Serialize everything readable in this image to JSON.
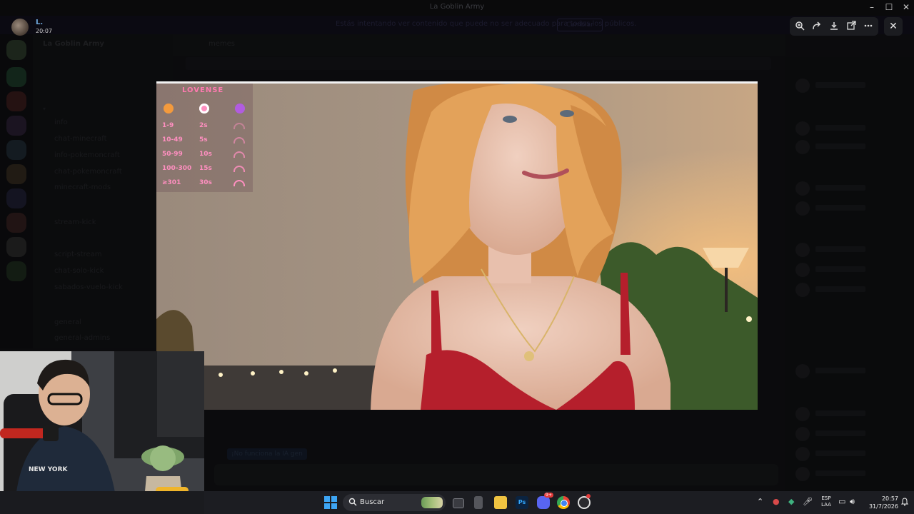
{
  "window": {
    "app_title": "La Goblin Army",
    "controls": {
      "minimize": "–",
      "maximize": "☐",
      "close": "✕"
    }
  },
  "banner": {
    "text": "Estás intentando ver contenido que puede no ser adecuado para todos los públicos.",
    "button": "Cambiar"
  },
  "user": {
    "name": "L.",
    "time": "20:07"
  },
  "server": {
    "name": "La Goblin Army",
    "channels": [
      {
        "label": "info"
      },
      {
        "label": "chat-minecraft"
      },
      {
        "label": "info-pokemoncraft"
      },
      {
        "label": "chat-pokemoncraft"
      },
      {
        "label": "minecraft-mods"
      },
      {
        "label": "stream-kick"
      },
      {
        "label": "script-stream"
      },
      {
        "label": "chat-solo-kick"
      },
      {
        "label": "sabados-vuelo-kick"
      },
      {
        "label": "general"
      },
      {
        "label": "general-admins"
      }
    ]
  },
  "chat": {
    "channel_name": "memes",
    "reply_button": "¡No funciona la IA gen"
  },
  "viewer": {
    "toolbar_icons": [
      "zoom-icon",
      "forward-icon",
      "download-icon",
      "open-external-icon",
      "more-icon"
    ],
    "close_symbol": "✕"
  },
  "lovense": {
    "logo": "LOVENSE",
    "levels": [
      {
        "tip": "1-9",
        "duration": "2s",
        "strength": 0.2
      },
      {
        "tip": "10-49",
        "duration": "5s",
        "strength": 0.4
      },
      {
        "tip": "50-99",
        "duration": "10s",
        "strength": 0.6
      },
      {
        "tip": "100-300",
        "duration": "15s",
        "strength": 0.8
      },
      {
        "tip": "≥301",
        "duration": "30s",
        "strength": 1.0
      }
    ],
    "colors": {
      "pink": "#ff8fc0",
      "orange": "#f39a3d",
      "purple": "#b15ce0"
    }
  },
  "taskbar": {
    "search_text": "Buscar",
    "apps": [
      "task-view-icon",
      "terminal-icon",
      "file-explorer-icon",
      "photoshop-icon",
      "discord-icon",
      "chrome-icon",
      "obs-icon"
    ],
    "discord_badge": "9+",
    "lang_line1": "ESP",
    "lang_line2": "LAA",
    "clock_time": "20:57",
    "clock_date": "31/7/2026"
  }
}
